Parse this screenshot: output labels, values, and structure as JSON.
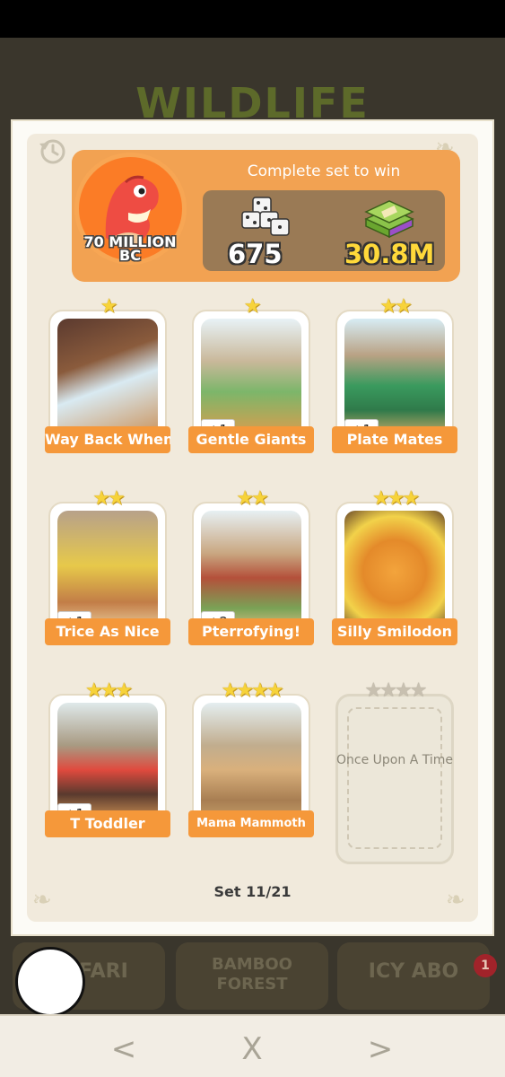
{
  "background": {
    "title": "WILDLIFE",
    "albums": [
      "SAFARI",
      "BAMBOO FOREST",
      "ICY ABO"
    ],
    "notification_count": "1"
  },
  "set": {
    "name_line1": "70 MILLION",
    "name_line2": "BC",
    "complete_text": "Complete set to win",
    "dice_reward": "675",
    "cash_reward": "30.8M",
    "counter": "Set 11/21"
  },
  "cards": [
    {
      "name": "Way Back When",
      "stars": 1,
      "duplicate": ""
    },
    {
      "name": "Gentle Giants",
      "stars": 1,
      "duplicate": "+1"
    },
    {
      "name": "Plate Mates",
      "stars": 2,
      "duplicate": "+1"
    },
    {
      "name": "Trice As Nice",
      "stars": 2,
      "duplicate": "+1"
    },
    {
      "name": "Pterrofying!",
      "stars": 2,
      "duplicate": "+2"
    },
    {
      "name": "Silly Smilodon",
      "stars": 3,
      "duplicate": ""
    },
    {
      "name": "T Toddler",
      "stars": 3,
      "duplicate": "+1"
    },
    {
      "name": "Mama Mammoth",
      "stars": 4,
      "duplicate": ""
    },
    {
      "name": "Once Upon A Time",
      "stars": 4,
      "duplicate": "",
      "locked": true
    }
  ],
  "nav": {
    "back_glyph": "<",
    "close_glyph": "X",
    "forward_glyph": ">"
  },
  "colors": {
    "accent_orange": "#f5983a",
    "header_orange": "#f2a252",
    "star_gold": "#f7d33a"
  },
  "icons": [
    "history-icon",
    "dice-stack-icon",
    "cash-stack-icon",
    "star-icon",
    "chevron-left-icon",
    "close-icon",
    "chevron-right-icon"
  ]
}
